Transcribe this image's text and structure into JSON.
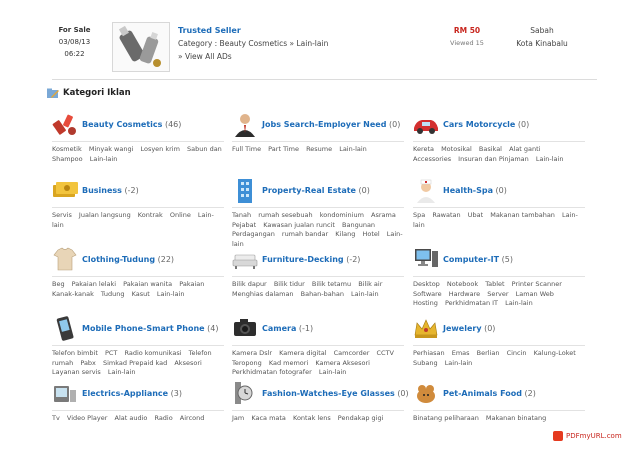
{
  "listing": {
    "sale_label": "For Sale",
    "date": "03/08/13",
    "time": "06:22",
    "title": "Trusted Seller",
    "category_path": "Category : Beauty Cosmetics » Lain-lain",
    "view_all": "» View All ADs",
    "price": "RM 50",
    "viewed": "Viewed 15",
    "state": "Sabah",
    "city": "Kota Kinabalu"
  },
  "heading": {
    "label": "Kategori Iklan"
  },
  "categories": [
    {
      "label": "Beauty Cosmetics",
      "count": "(46)",
      "icon": "lipstick-icon",
      "subs": [
        "Kosmetik",
        "Minyak wangi",
        "Losyen krim",
        "Sabun dan Shampoo",
        "Lain-lain"
      ]
    },
    {
      "label": "Jobs Search-Employer Need",
      "count": "(0)",
      "icon": "businessman-icon",
      "subs": [
        "Full Time",
        "Part Time",
        "Resume",
        "Lain-lain"
      ]
    },
    {
      "label": "Cars Motorcycle",
      "count": "(0)",
      "icon": "red-car-icon",
      "subs": [
        "Kereta",
        "Motosikal",
        "Basikal",
        "Alat ganti",
        "Accessories",
        "Insuran dan Pinjaman",
        "Lain-lain"
      ]
    },
    {
      "label": "Business",
      "count": "(-2)",
      "icon": "money-icon",
      "subs": [
        "Servis",
        "Jualan langsung",
        "Kontrak",
        "Online",
        "Lain-lain"
      ]
    },
    {
      "label": "Property-Real Estate",
      "count": "(0)",
      "icon": "building-icon",
      "subs": [
        "Tanah",
        "rumah sesebuah",
        "kondominium",
        "Asrama",
        "Pejabat",
        "Kawasan jualan runcit",
        "Bangunan Perdagangan",
        "rumah bandar",
        "Kilang",
        "Hotel",
        "Lain-lain"
      ]
    },
    {
      "label": "Health-Spa",
      "count": "(0)",
      "icon": "nurse-icon",
      "subs": [
        "Spa",
        "Rawatan",
        "Ubat",
        "Makanan tambahan",
        "Lain-lain"
      ]
    },
    {
      "label": "Clothing-Tudung",
      "count": "(22)",
      "icon": "tshirt-icon",
      "subs": [
        "Beg",
        "Pakaian lelaki",
        "Pakaian wanita",
        "Pakaian Kanak-kanak",
        "Tudung",
        "Kasut",
        "Lain-lain"
      ]
    },
    {
      "label": "Furniture-Decking",
      "count": "(-2)",
      "icon": "sofa-icon",
      "subs": [
        "Bilik dapur",
        "Bilik tidur",
        "Bilik tetamu",
        "Bilik air",
        "Menghias dalaman",
        "Bahan-bahan",
        "Lain-lain"
      ]
    },
    {
      "label": "Computer-IT",
      "count": "(5)",
      "icon": "computer-icon",
      "subs": [
        "Desktop",
        "Notebook",
        "Tablet",
        "Printer Scanner",
        "Software",
        "Hardware",
        "Server",
        "Laman Web",
        "Hosting",
        "Perkhidmatan IT",
        "Lain-lain"
      ]
    },
    {
      "label": "Mobile Phone-Smart Phone",
      "count": "(4)",
      "icon": "mobile-phone-icon",
      "subs": [
        "Telefon bimbit",
        "PCT",
        "Radio komunikasi",
        "Telefon rumah",
        "Pabx",
        "Simkad Prepaid kad",
        "Aksesori",
        "Layanan servis",
        "Lain-lain"
      ]
    },
    {
      "label": "Camera",
      "count": "(-1)",
      "icon": "camera-icon",
      "subs": [
        "Kamera Dslr",
        "Kamera digital",
        "Camcorder",
        "CCTV",
        "Teropong",
        "Kad memori",
        "Kamera Aksesori",
        "Perkhidmatan fotografer",
        "Lain-lain"
      ]
    },
    {
      "label": "Jewelery",
      "count": "(0)",
      "icon": "crown-icon",
      "subs": [
        "Perhiasan",
        "Emas",
        "Berlian",
        "Cincin",
        "Kalung-Loket",
        "Subang",
        "Lain-lain"
      ]
    },
    {
      "label": "Electrics-Appliance",
      "count": "(3)",
      "icon": "appliance-icon",
      "subs": [
        "Tv",
        "Video Player",
        "Alat audio",
        "Radio",
        "Aircond"
      ]
    },
    {
      "label": "Fashion-Watches-Eye Glasses",
      "count": "(0)",
      "icon": "watch-icon",
      "subs": [
        "Jam",
        "Kaca mata",
        "Kontak lens",
        "Pendakap gigi"
      ]
    },
    {
      "label": "Pet-Animals Food",
      "count": "(2)",
      "icon": "pet-icon",
      "subs": [
        "Binatang peliharaan",
        "Makanan binatang"
      ]
    }
  ],
  "footer": {
    "badge": "PDFmyURL.com"
  },
  "colors": {
    "link_blue": "#1d6cb8",
    "price_red": "#c8261e"
  }
}
